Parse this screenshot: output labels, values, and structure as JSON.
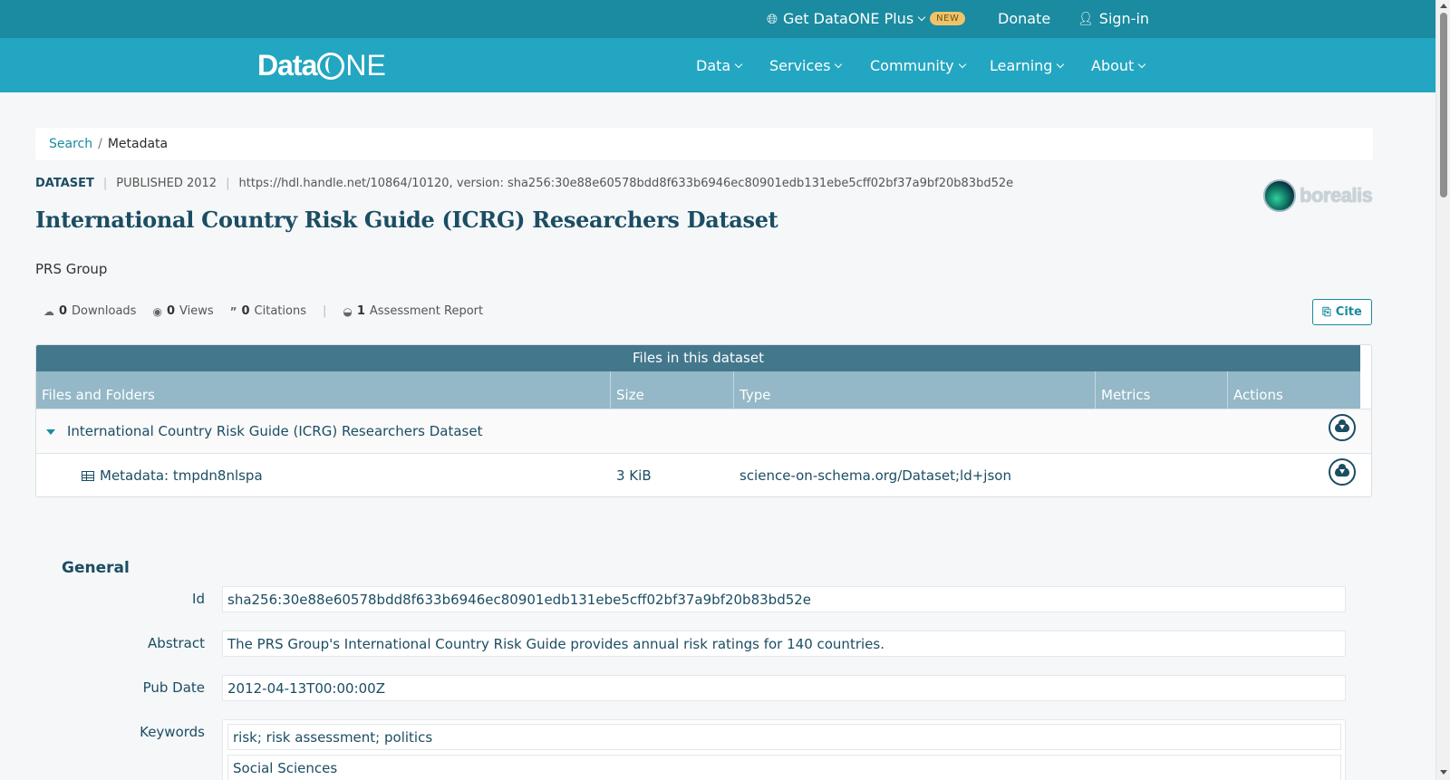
{
  "topbar": {
    "plus_label": "Get DataONE Plus",
    "new_badge": "NEW",
    "donate_label": "Donate",
    "signin_label": "Sign-in"
  },
  "navbar": {
    "logo_text_a": "Data",
    "logo_text_b": "NE",
    "items": [
      "Data",
      "Services",
      "Community",
      "Learning",
      "About"
    ]
  },
  "breadcrumb": {
    "search": "Search",
    "separator": "/",
    "current": "Metadata"
  },
  "dataset": {
    "type": "DATASET",
    "published": "PUBLISHED 2012",
    "identifier_line": "https://hdl.handle.net/10864/10120, version: sha256:30e88e60578bdd8f633b6946ec80901edb131ebe5cff02bf37a9bf20b83bd52e",
    "title": "International Country Risk Guide (ICRG) Researchers Dataset",
    "creator": "PRS Group",
    "repository_logo": "borealis"
  },
  "metrics": {
    "downloads_count": "0",
    "downloads_label": "Downloads",
    "views_count": "0",
    "views_label": "Views",
    "citations_count": "0",
    "citations_label": "Citations",
    "assessment_count": "1",
    "assessment_label": "Assessment Report"
  },
  "cite_label": "Cite",
  "files": {
    "header": "Files in this dataset",
    "columns": [
      "Files and Folders",
      "Size",
      "Type",
      "Metrics",
      "Actions"
    ],
    "folder_name": "International Country Risk Guide (ICRG) Researchers Dataset",
    "file": {
      "name": "Metadata: tmpdn8nlspa",
      "size": "3 KiB",
      "type": "science-on-schema.org/Dataset;ld+json"
    }
  },
  "general": {
    "heading": "General",
    "id_label": "Id",
    "id_value": "sha256:30e88e60578bdd8f633b6946ec80901edb131ebe5cff02bf37a9bf20b83bd52e",
    "abstract_label": "Abstract",
    "abstract_value": "The PRS Group's International Country Risk Guide provides annual risk ratings for 140 countries.",
    "pubdate_label": "Pub Date",
    "pubdate_value": "2012-04-13T00:00:00Z",
    "keywords_label": "Keywords",
    "keywords": [
      "risk; risk assessment; politics",
      "Social Sciences"
    ]
  },
  "colors": {
    "topbar": "#1a8ba0",
    "navbar": "#23a6c1",
    "title": "#1b4d63",
    "table_header": "#43778c",
    "table_cols": "#94b8c7"
  }
}
